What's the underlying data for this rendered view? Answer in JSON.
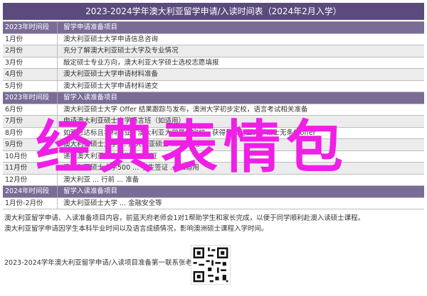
{
  "title": "2023-2024学年澳大利亚留学申请/入读时间表（2024年2月入学）",
  "rows": [
    {
      "type": "section",
      "time": "2023年时间段",
      "item": "留学申请准备项目"
    },
    {
      "type": "data",
      "time": "1月份",
      "item": "澳大利亚硕士大学申请信息咨询"
    },
    {
      "type": "data",
      "time": "2月份",
      "item": "充分了解澳大利亚硕士大学及专业情况"
    },
    {
      "type": "data",
      "time": "3月份",
      "item": "敲定硕士专业方向，澳大利亚大学硕士选校志愿填报"
    },
    {
      "type": "data",
      "time": "4月份",
      "item": "澳大利亚硕士大学申请材料准备"
    },
    {
      "type": "data",
      "time": "5月份",
      "item": "澳大利亚硕士大学申请材料递交"
    },
    {
      "type": "section",
      "time": "2023年时间段",
      "item": "留学入读准备项目"
    },
    {
      "type": "data",
      "time": "6月份",
      "item": "澳大利亚硕士大学 Offer 结果跟踪与发布，澳洲大学初步定校，语言考试相关准备"
    },
    {
      "type": "data",
      "time": "7月份",
      "item": "申请澳大利亚硕士大学语言班（如适用）"
    },
    {
      "type": "data",
      "time": "8月份",
      "item": "如雅思达标且本科毕业，澳大利亚大学最终定校，获得澳大利亚大学硕士无条件offer"
    },
    {
      "type": "data",
      "time": "9月份",
      "item": "澳大利亚硕士大学 ... 澳大利亚硕士 ... 如适用"
    },
    {
      "type": "data",
      "time": "10月份",
      "item": "递交澳大利亚硕士大学500签证"
    },
    {
      "type": "data",
      "time": "11月份",
      "item": "澳大利亚硕士大学500 ... 学生签证 ... 如适用"
    },
    {
      "type": "data",
      "time": "12月份",
      "item": "澳大利亚 ... 行前 ... 准备"
    },
    {
      "type": "section",
      "time": "2024年时间段",
      "item": "留学入读准备项目"
    },
    {
      "type": "data",
      "time": "1月份-2月份",
      "item": "澳大利亚硕士大学 ... 金融安全等"
    }
  ],
  "watermark": "经典表情包",
  "notes": [
    "澳大利亚留学申请、入读准备项目内容，前蓝天府老师会1对1帮助学生和家长完成，以便于同学顺利赴澳入读硕士课程。",
    "澳大利亚留学申请因学生本科毕业时间以及语言成绩情况，影响澳洲硕士课程入学时间。"
  ],
  "contact_label": "2023-2024学年澳大利亚留学申请/入读项目准备第一联系张老师："
}
